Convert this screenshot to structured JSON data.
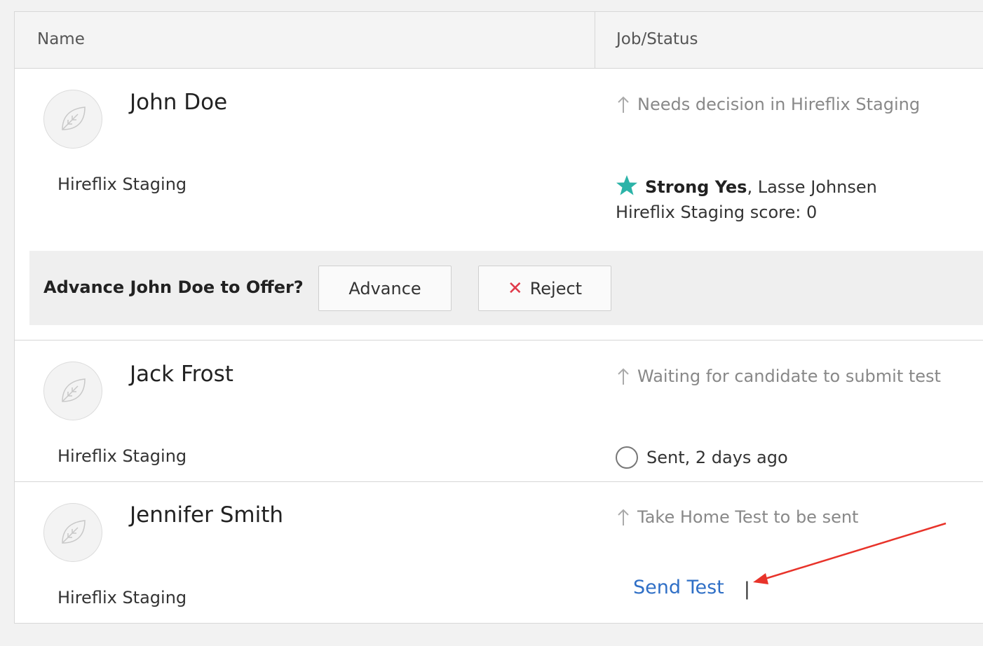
{
  "table": {
    "columns": [
      "Name",
      "Job/Status"
    ]
  },
  "candidates": [
    {
      "name": "John Doe",
      "company": "Hireflix Staging",
      "status": "Needs decision in Hireflix Staging",
      "review_rating": "Strong Yes",
      "reviewer": ", Lasse Johnsen",
      "score_line": "Hireflix Staging score: 0",
      "decision_prompt": "Advance John Doe to Offer?",
      "advance_label": "Advance",
      "reject_label": "Reject"
    },
    {
      "name": "Jack Frost",
      "company": "Hireflix Staging",
      "status": "Waiting for candidate to submit test",
      "sent_text": "Sent, 2 days ago"
    },
    {
      "name": "Jennifer Smith",
      "company": "Hireflix Staging",
      "status": "Take Home Test to be sent",
      "send_test_label": "Send Test",
      "separator": "|"
    }
  ],
  "icons": {
    "avatar": "leaf-icon",
    "status": "arrow-up-icon",
    "rating": "star-icon",
    "reject": "close-icon"
  },
  "colors": {
    "star": "#2bb3a8",
    "reject": "#e03a4a",
    "link": "#2f6fc6",
    "annotation": "#e8332a"
  }
}
